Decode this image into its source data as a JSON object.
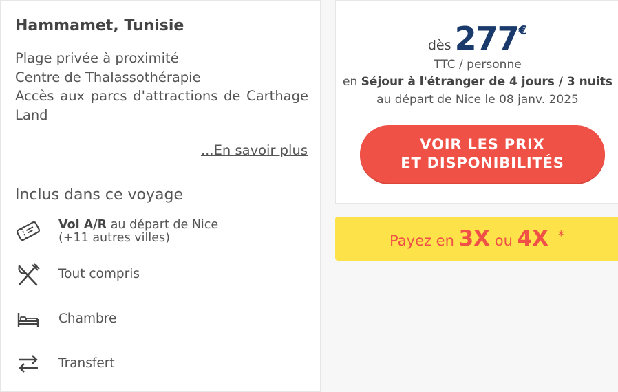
{
  "hotel": {
    "name": "Hammamet, Tunisie",
    "features": [
      "Plage privée à proximité",
      "Centre de Thalassothérapie",
      "Accès aux parcs d'attractions de Carthage Land"
    ],
    "learn_more": "...En savoir plus"
  },
  "included": {
    "title": "Inclus dans ce voyage",
    "flight_bold": "Vol A/R",
    "flight_rest": " au départ de Nice",
    "flight_extra": "(+11 autres villes)",
    "all_inclusive": "Tout compris",
    "room": "Chambre",
    "transfer": "Transfert",
    "icons": [
      "ticket-icon",
      "cutlery-icon",
      "bed-icon",
      "transfer-arrows-icon"
    ]
  },
  "price": {
    "from_label": "dès",
    "amount": "277",
    "currency": "€",
    "per_person": "TTC / personne",
    "stay_prefix": "en ",
    "stay_type": "Séjour à l'étranger de 4 jours / 3 nuits",
    "departure": "au départ de Nice le 08 janv. 2025",
    "cta_line1": "VOIR LES PRIX",
    "cta_line2": "ET DISPONIBILITÉS"
  },
  "payment": {
    "prefix": "Payez en ",
    "option1": "3X",
    "middle": " ou ",
    "option2": "4X",
    "star": "*"
  },
  "colors": {
    "accent_red": "#ef5147",
    "price_blue": "#1a3a6b",
    "banner_yellow": "#fde24a"
  }
}
